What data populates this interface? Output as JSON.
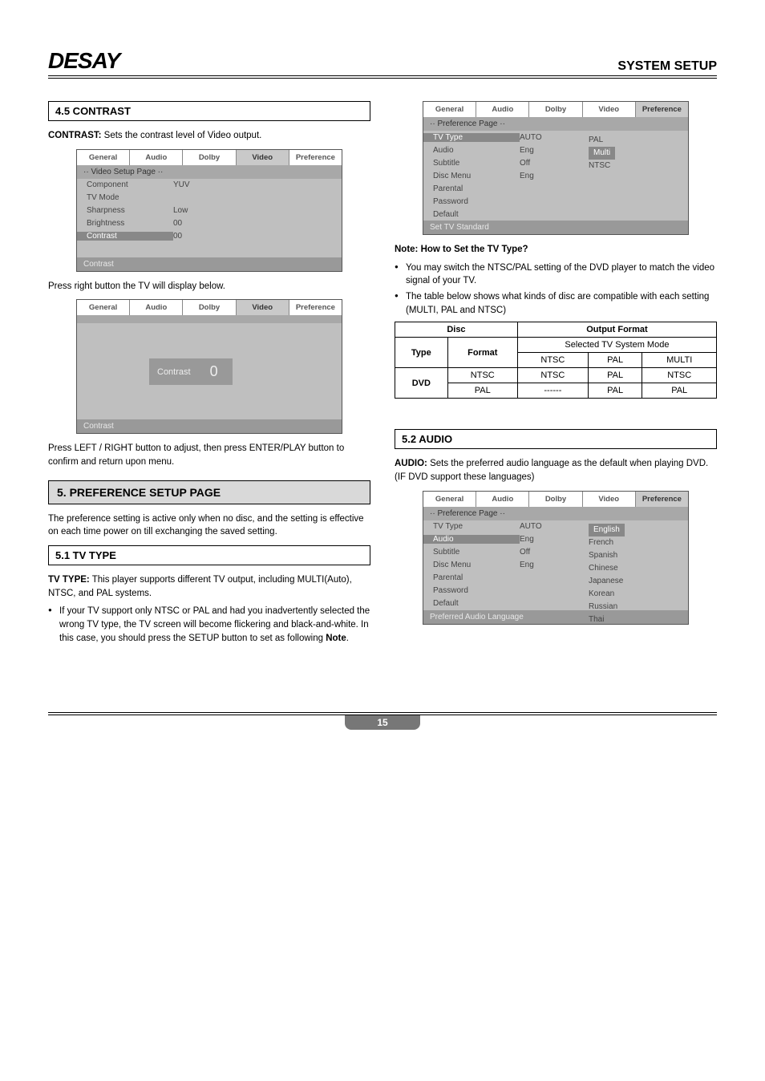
{
  "header": {
    "brand": "DESAY",
    "page_title": "SYSTEM SETUP"
  },
  "left": {
    "s45_title": "4.5 CONTRAST",
    "contrast_desc_label": "CONTRAST:",
    "contrast_desc": " Sets the contrast level of Video output.",
    "press_right": "Press right button the TV will display below.",
    "press_lr": "Press  LEFT / RIGHT  button  to  adjust,  then press ENTER/PLAY  button  to  confirm  and  return  upon menu.",
    "s5_title": "5. PREFERENCE SETUP PAGE",
    "s5_desc": "The preference  setting   is active  only when no disc, and the setting is effective on each time power on till exchanging the saved setting.",
    "s51_title": "5.1 TV TYPE",
    "tvtype_label": "TV TYPE:",
    "tvtype_desc": "   This player supports different TV output, including MULTI(Auto),  NTSC,  and PAL systems.",
    "tvtype_bullet": "If your TV support only NTSC or PAL and had you inadvertently selected  the wrong TV type,  the TV screen will become flickering and black-and-white. In  this case,  you should press the SETUP button to set as following ",
    "tvtype_bullet_bold": "Note",
    "menu_video": {
      "tabs": [
        "General",
        "Audio",
        "Dolby",
        "Video",
        "Preference"
      ],
      "active_tab": 3,
      "heading": "·· Video Setup Page ··",
      "rows": [
        {
          "l": "Component",
          "m": "YUV"
        },
        {
          "l": "TV Mode",
          "m": ""
        },
        {
          "l": "Sharpness",
          "m": "Low"
        },
        {
          "l": "Brightness",
          "m": "00"
        },
        {
          "l": "Contrast",
          "m": "00",
          "hl": true
        }
      ],
      "footer": "Contrast"
    },
    "menu_slider": {
      "tabs": [
        "General",
        "Audio",
        "Dolby",
        "Video",
        "Preference"
      ],
      "active_tab": 3,
      "label": "Contrast",
      "value": "0",
      "footer": "Contrast"
    }
  },
  "right": {
    "menu_pref1": {
      "tabs": [
        "General",
        "Audio",
        "Dolby",
        "Video",
        "Preference"
      ],
      "active_tab": 4,
      "heading": "·· Preference Page ··",
      "rows": [
        {
          "l": "TV Type",
          "m": "AUTO",
          "hl": true,
          "opts": [
            "PAL",
            "Multi",
            "NTSC"
          ],
          "opt_sel": 1
        },
        {
          "l": "Audio",
          "m": "Eng"
        },
        {
          "l": "Subtitle",
          "m": "Off"
        },
        {
          "l": "Disc Menu",
          "m": "Eng"
        },
        {
          "l": "Parental",
          "m": ""
        },
        {
          "l": "Password",
          "m": ""
        },
        {
          "l": "Default",
          "m": ""
        }
      ],
      "footer": "Set TV Standard"
    },
    "note_title": "Note: How to Set the TV Type?",
    "note_b1": "You may switch the NTSC/PAL setting of the DVD player to match the  video  signal of  your TV.",
    "note_b2": "The table below shows what kinds of disc are compatible with each setting (MULTI, PAL and NTSC)",
    "s52_title": "5.2 AUDIO",
    "audio_label": "AUDIO:",
    "audio_desc": "  Sets  the preferred  audio language as  the default  when  playing DVD. (IF  DVD  support  these languages)",
    "menu_pref2": {
      "tabs": [
        "General",
        "Audio",
        "Dolby",
        "Video",
        "Preference"
      ],
      "active_tab": 4,
      "heading": "·· Preference Page ··",
      "rows": [
        {
          "l": "TV Type",
          "m": "AUTO"
        },
        {
          "l": "Audio",
          "m": "Eng",
          "hl": true,
          "opts": [
            "English",
            "French",
            "Spanish",
            "Chinese",
            "Japanese",
            "Korean",
            "Russian",
            "Thai"
          ],
          "opt_sel": 0
        },
        {
          "l": "Subtitle",
          "m": "Off"
        },
        {
          "l": "Disc Menu",
          "m": "Eng"
        },
        {
          "l": "Parental",
          "m": ""
        },
        {
          "l": "Password",
          "m": ""
        },
        {
          "l": "Default",
          "m": ""
        }
      ],
      "footer": "Preferred Audio Language"
    }
  },
  "chart_data": {
    "type": "table",
    "title": "Disc Output Format Compatibility",
    "columns_top": [
      "Disc",
      "Output Format"
    ],
    "columns_sub_left": [
      "Type",
      "Format"
    ],
    "columns_sub_right_header": "Selected TV System Mode",
    "columns_sub_right": [
      "NTSC",
      "PAL",
      "MULTI"
    ],
    "rows": [
      {
        "type": "DVD",
        "format": "NTSC",
        "NTSC": "NTSC",
        "PAL": "PAL",
        "MULTI": "NTSC"
      },
      {
        "type": "DVD",
        "format": "PAL",
        "NTSC": "------",
        "PAL": "PAL",
        "MULTI": "PAL"
      }
    ]
  },
  "page_number": "15"
}
